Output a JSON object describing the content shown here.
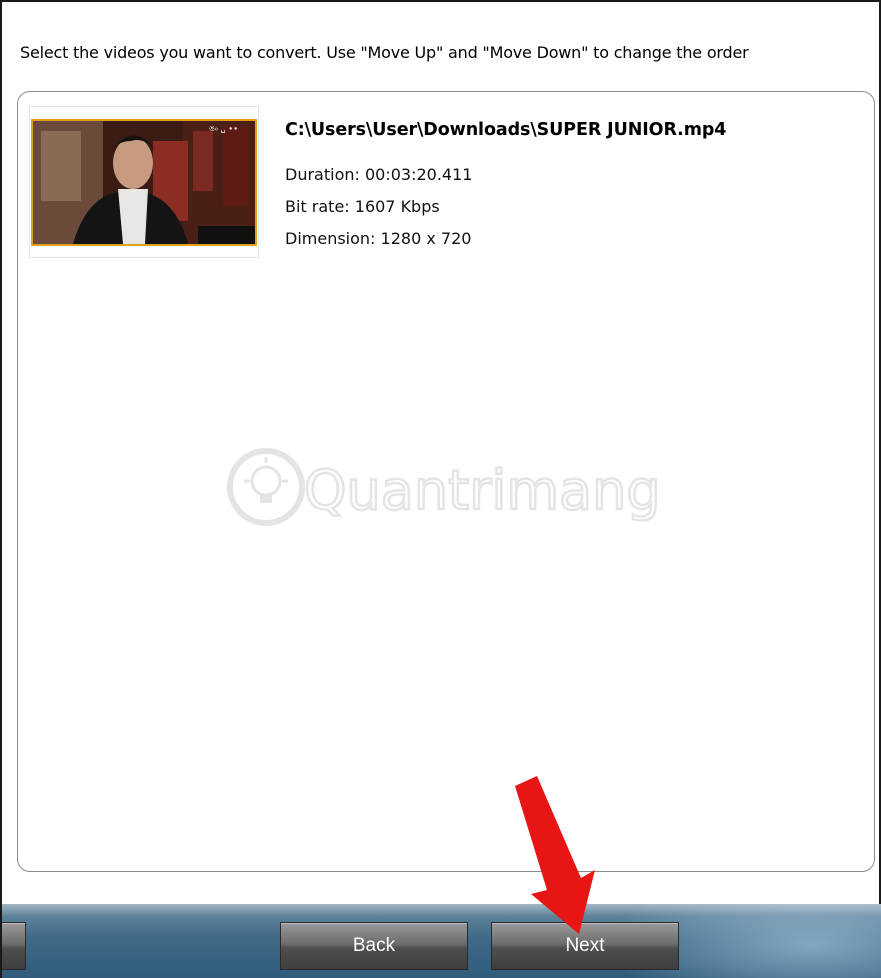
{
  "instruction": "Select the videos you want to convert. Use \"Move Up\" and \"Move Down\" to change the order",
  "video": {
    "path": "C:\\Users\\User\\Downloads\\SUPER JUNIOR.mp4",
    "duration": "Duration: 00:03:20.411",
    "bitrate": "Bit rate: 1607 Kbps",
    "dimension": "Dimension: 1280 x 720"
  },
  "watermark": "Quantrimang",
  "buttons": {
    "back": "Back",
    "next": "Next"
  },
  "colors": {
    "thumbnail_border": "#e2a019",
    "arrow": "#e81515",
    "bar": "#3f6a88"
  },
  "icons": {
    "arrow": "red-arrow-annotation",
    "watermark": "lightbulb-logo"
  }
}
